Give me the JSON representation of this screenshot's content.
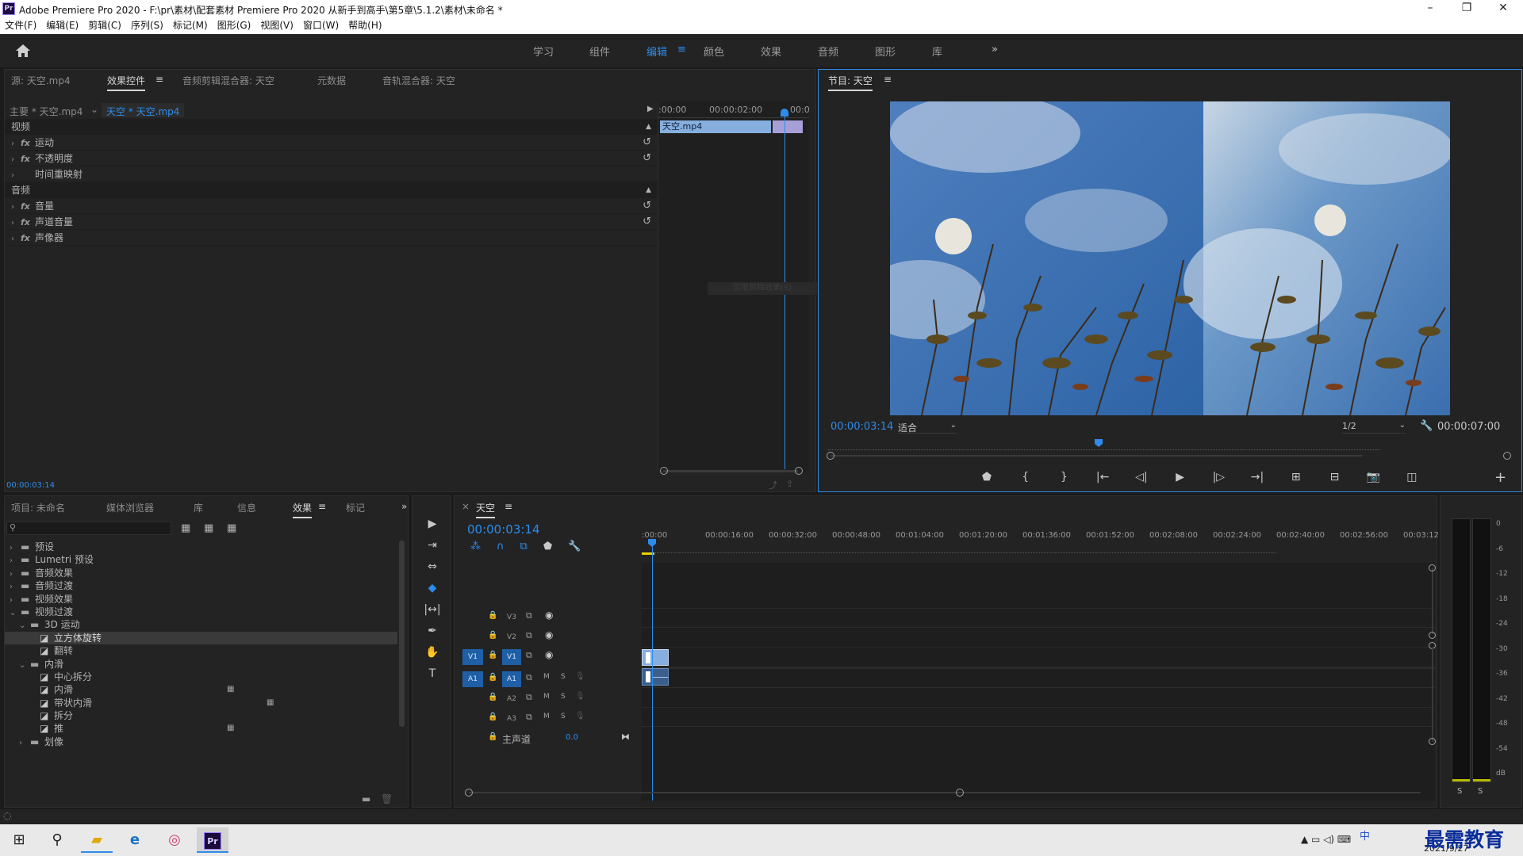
{
  "window": {
    "title": "Adobe Premiere Pro 2020 - F:\\pr\\素材\\配套素材 Premiere Pro 2020 从新手到高手\\第5章\\5.1.2\\素材\\未命名 *",
    "logo": "Pr",
    "minimize": "–",
    "maximize": "❐",
    "close": "✕"
  },
  "menu": [
    "文件(F)",
    "编辑(E)",
    "剪辑(C)",
    "序列(S)",
    "标记(M)",
    "图形(G)",
    "视图(V)",
    "窗口(W)",
    "帮助(H)"
  ],
  "workspaces": {
    "items": [
      "学习",
      "组件",
      "编辑",
      "颜色",
      "效果",
      "音频",
      "图形",
      "库"
    ],
    "active_index": 2,
    "edit_menu_icon": "≡",
    "more": "»"
  },
  "effect_controls": {
    "tabs": [
      "源: 天空.mp4",
      "效果控件",
      "音频剪辑混合器: 天空",
      "元数据",
      "音轨混合器: 天空"
    ],
    "tab_menu": "≡",
    "master": "主要 * 天空.mp4",
    "clip": "天空 * 天空.mp4",
    "ruler_times": [
      ":00:00",
      "00:00:02:00",
      "00:0"
    ],
    "clip_name": "天空.mp4",
    "video_header": "视频",
    "video_effects": [
      {
        "name": "运动",
        "fx": "fx",
        "reset": true
      },
      {
        "name": "不透明度",
        "fx": "fx",
        "reset": true
      },
      {
        "name": "时间重映射",
        "fx": "",
        "reset": false
      }
    ],
    "audio_header": "音频",
    "audio_effects": [
      {
        "name": "音量",
        "fx": "fx",
        "reset": true
      },
      {
        "name": "声道音量",
        "fx": "fx",
        "reset": true
      },
      {
        "name": "声像器",
        "fx": "fx",
        "reset": false
      }
    ],
    "faint_tooltip": "仅限剪辑效果(S)",
    "timecode": "00:00:03:14"
  },
  "program": {
    "title": "节目: 天空",
    "menu": "≡",
    "timecode": "00:00:03:14",
    "fit": "适合",
    "resolution": "1/2",
    "duration": "00:00:07:00",
    "playhead_fraction": 0.49,
    "transport": [
      "⬟",
      "{",
      "}",
      "|←",
      "◁|",
      "▶",
      "|▷",
      "→|",
      "⊞",
      "⊟",
      "📷",
      "◫"
    ],
    "add": "+"
  },
  "project": {
    "tabs": [
      "项目: 未命名",
      "媒体浏览器",
      "库",
      "信息",
      "效果",
      "标记"
    ],
    "active_tab_index": 4,
    "more": "»",
    "search_placeholder": "",
    "tree": [
      {
        "label": "预设",
        "depth": 0,
        "type": "folder",
        "open": false
      },
      {
        "label": "Lumetri 预设",
        "depth": 0,
        "type": "folder",
        "open": false
      },
      {
        "label": "音频效果",
        "depth": 0,
        "type": "folder",
        "open": false
      },
      {
        "label": "音频过渡",
        "depth": 0,
        "type": "folder",
        "open": false
      },
      {
        "label": "视频效果",
        "depth": 0,
        "type": "folder",
        "open": false
      },
      {
        "label": "视频过渡",
        "depth": 0,
        "type": "folder",
        "open": true
      },
      {
        "label": "3D 运动",
        "depth": 1,
        "type": "folder",
        "open": true
      },
      {
        "label": "立方体旋转",
        "depth": 2,
        "type": "item",
        "selected": true
      },
      {
        "label": "翻转",
        "depth": 2,
        "type": "item"
      },
      {
        "label": "内滑",
        "depth": 1,
        "type": "folder",
        "open": true
      },
      {
        "label": "中心拆分",
        "depth": 2,
        "type": "item"
      },
      {
        "label": "内滑",
        "depth": 2,
        "type": "item",
        "badge": true
      },
      {
        "label": "带状内滑",
        "depth": 2,
        "type": "item",
        "badge2": true
      },
      {
        "label": "拆分",
        "depth": 2,
        "type": "item"
      },
      {
        "label": "推",
        "depth": 2,
        "type": "item",
        "badge": true
      },
      {
        "label": "划像",
        "depth": 1,
        "type": "folder",
        "open": false
      }
    ]
  },
  "timeline": {
    "close": "×",
    "name": "天空",
    "menu": "≡",
    "timecode": "00:00:03:14",
    "ruler": [
      ":00:00",
      "00:00:16:00",
      "00:00:32:00",
      "00:00:48:00",
      "00:01:04:00",
      "00:01:20:00",
      "00:01:36:00",
      "00:01:52:00",
      "00:02:08:00",
      "00:02:24:00",
      "00:02:40:00",
      "00:02:56:00",
      "00:03:12:"
    ],
    "video_tracks": [
      {
        "src": "",
        "name": "V3"
      },
      {
        "src": "",
        "name": "V2"
      },
      {
        "src": "V1",
        "name": "V1"
      }
    ],
    "audio_tracks": [
      {
        "src": "A1",
        "name": "A1"
      },
      {
        "src": "",
        "name": "A2"
      },
      {
        "src": "",
        "name": "A3"
      }
    ],
    "m": "M",
    "s": "S",
    "master_label": "主声道",
    "master_value": "0.0"
  },
  "tools": [
    "▶",
    "⇥",
    "⇔",
    "◆",
    "|↔|",
    "✒",
    "✋",
    "T"
  ],
  "meter": {
    "scale": [
      "0",
      "-6",
      "-12",
      "-18",
      "-24",
      "-30",
      "-36",
      "-42",
      "-48",
      "-54",
      "dB"
    ],
    "solo": [
      "S",
      "S"
    ]
  },
  "taskbar": {
    "start": "⊞",
    "search": "⚲",
    "clock_date": "2021/9/27",
    "watermark": "最需教育",
    "ime": "中"
  },
  "colors": {
    "accent": "#2d8ceb",
    "panel": "#232323",
    "bg": "#1b1b1b"
  }
}
